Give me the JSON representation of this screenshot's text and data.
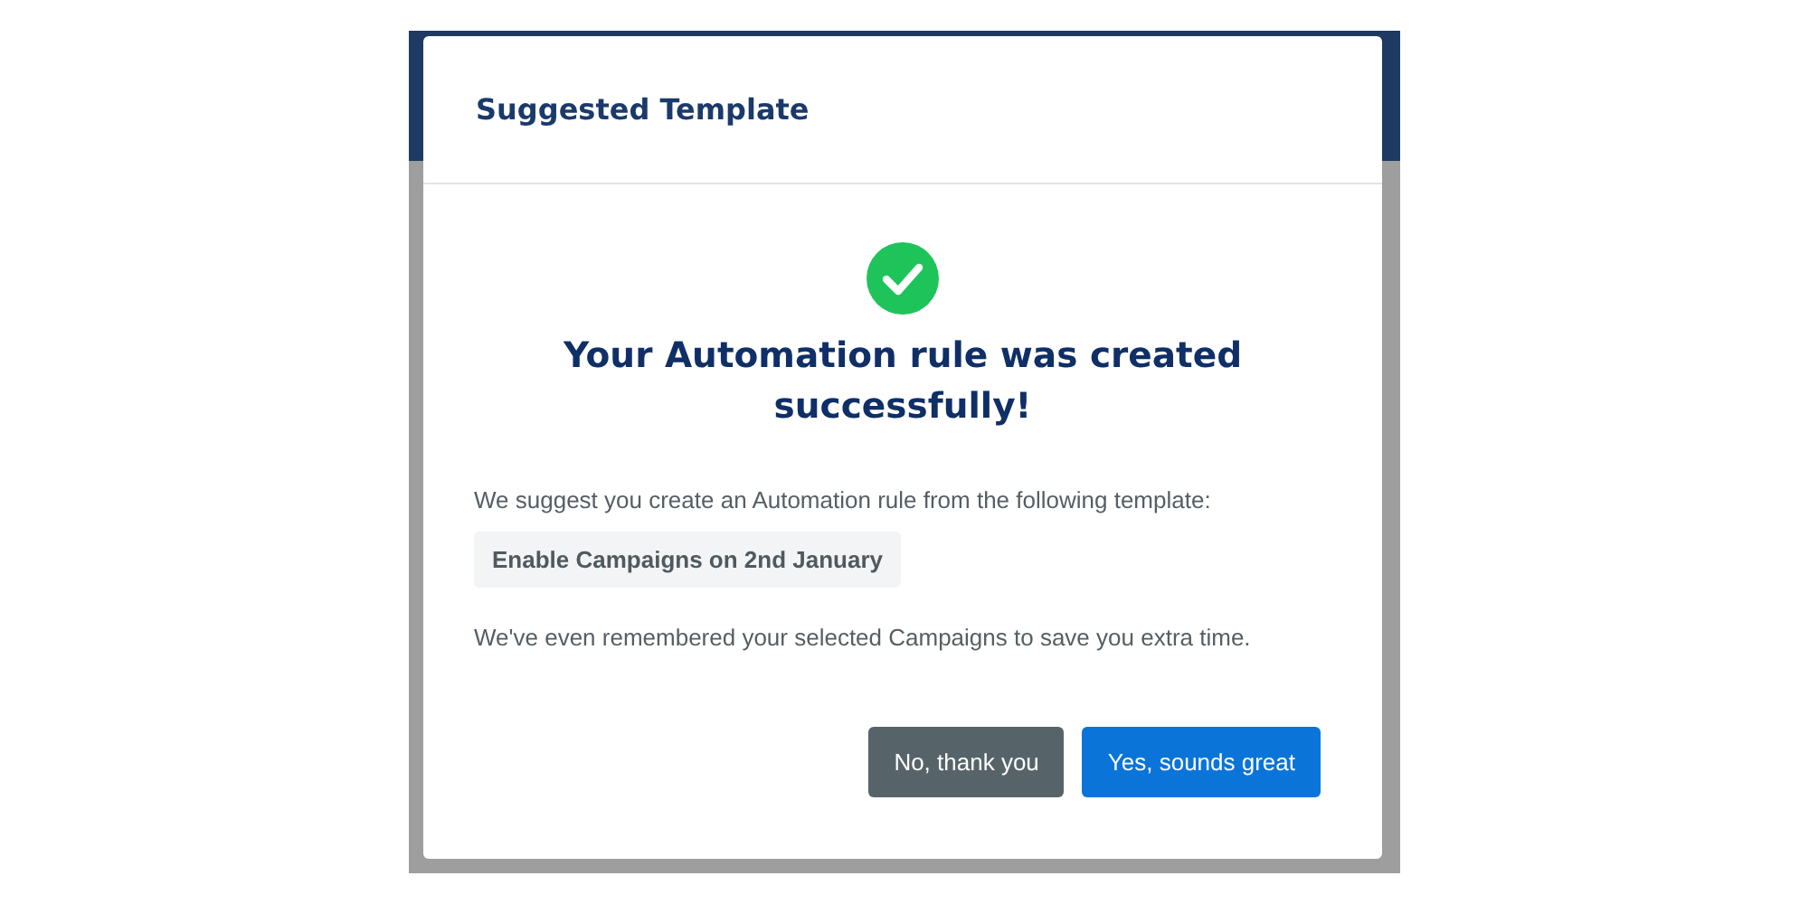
{
  "dialog": {
    "title": "Suggested Template",
    "success": true,
    "heading": "Your Automation rule was created successfully!",
    "intro": "We suggest you create an Automation rule from the following template:",
    "template": "Enable Campaigns on 2nd January",
    "note": "We've even remembered your selected Campaigns to save you extra time.",
    "buttons": [
      {
        "label": "No, thank you",
        "kind": "secondary"
      },
      {
        "label": "Yes, sounds great",
        "kind": "primary"
      }
    ]
  }
}
